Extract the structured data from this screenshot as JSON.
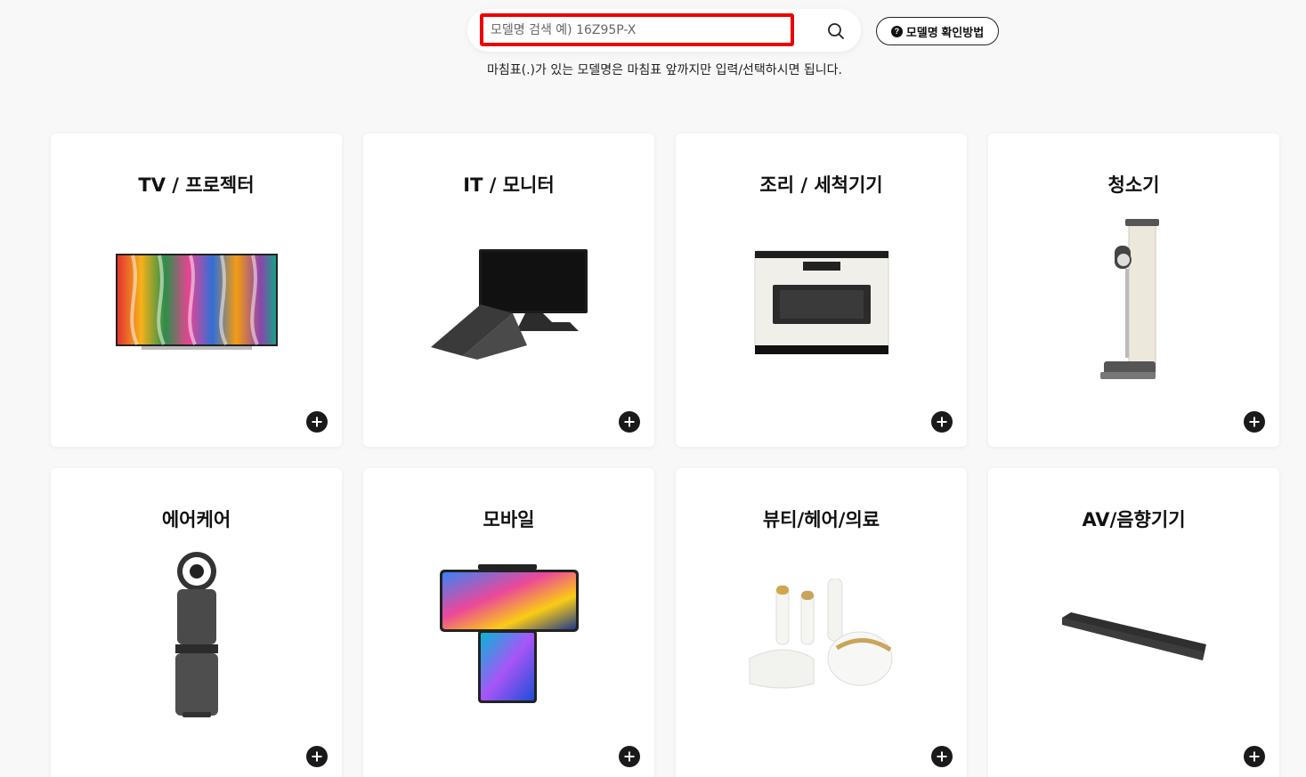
{
  "search": {
    "placeholder": "모델명 검색 예) 16Z95P-X",
    "value": "",
    "howto_label": "모델명 확인방법",
    "hint": "마침표(.)가 있는 모델명은 마침표 앞까지만 입력/선택하시면 됩니다."
  },
  "categories": [
    {
      "label": "TV / 프로젝터",
      "icon": "tv-image"
    },
    {
      "label": "IT / 모니터",
      "icon": "monitor-laptop-image"
    },
    {
      "label": "조리 / 세척기기",
      "icon": "oven-image"
    },
    {
      "label": "청소기",
      "icon": "vacuum-image"
    },
    {
      "label": "에어케어",
      "icon": "air-purifier-image"
    },
    {
      "label": "모바일",
      "icon": "phone-image"
    },
    {
      "label": "뷰티/헤어/의료",
      "icon": "beauty-devices-image"
    },
    {
      "label": "AV/음향기기",
      "icon": "soundbar-image"
    }
  ],
  "colors": {
    "accent": "#ee0000",
    "background": "#f8f8f8",
    "card": "#ffffff",
    "button": "#1a1a1a"
  }
}
